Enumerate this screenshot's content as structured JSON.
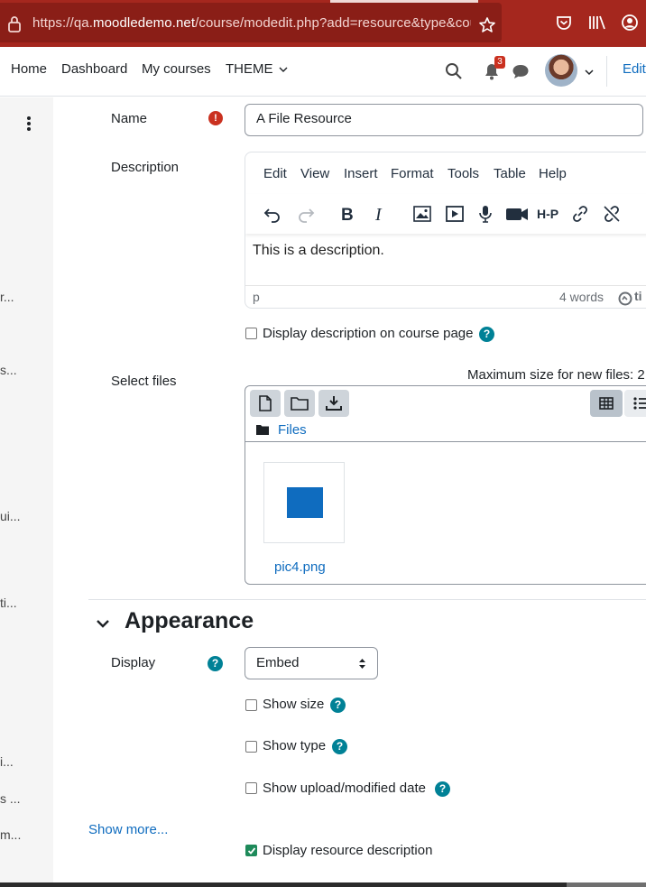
{
  "browser": {
    "url_prefix": "https://qa.",
    "url_domain": "moodledemo.net",
    "url_path": "/course/modedit.php?add=resource&type&course",
    "icons": [
      "lock-icon",
      "bookmark-star-icon",
      "pocket-icon",
      "library-icon",
      "account-icon"
    ]
  },
  "navbar": {
    "home": "Home",
    "dashboard": "Dashboard",
    "my_courses": "My courses",
    "theme": "THEME",
    "notification_count": "3",
    "edit_mode": "Edit"
  },
  "drawer": {
    "items": [
      "r...",
      "s...",
      "ui...",
      "ti...",
      "i...",
      "s ...",
      "m..."
    ]
  },
  "form": {
    "name_label": "Name",
    "name_value": "A File Resource",
    "description_label": "Description",
    "editor_menu": [
      "Edit",
      "View",
      "Insert",
      "Format",
      "Tools",
      "Table",
      "Help"
    ],
    "editor_content": "This is a description.",
    "editor_path": "p",
    "editor_wordcount": "4 words",
    "editor_brand": "ti",
    "display_description_label": "Display description on course page",
    "select_files_label": "Select files",
    "max_size_text": "Maximum size for new files: 2",
    "files_path": "Files",
    "file_name": "pic4.png"
  },
  "appearance": {
    "title": "Appearance",
    "display_label": "Display",
    "display_value": "Embed",
    "show_size": "Show size",
    "show_type": "Show type",
    "show_date": "Show upload/modified date",
    "show_more": "Show more...",
    "display_resource_description": "Display resource description"
  },
  "colors": {
    "accent": "#0f6cbf",
    "help": "#008196",
    "required": "#ca3120",
    "browser_bar": "#a5271e"
  }
}
